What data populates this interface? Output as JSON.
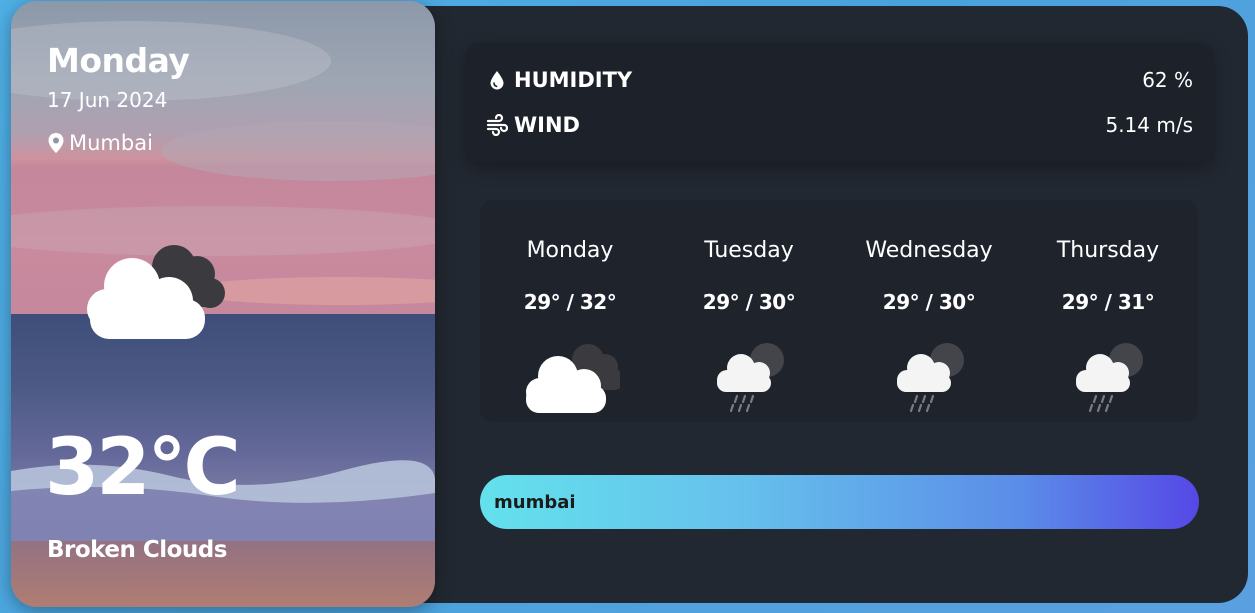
{
  "current": {
    "day": "Monday",
    "date": "17 Jun 2024",
    "location": "Mumbai",
    "location_icon": "map-pin-icon",
    "temperature": "32°C",
    "condition": "Broken Clouds",
    "condition_icon": "broken-clouds-icon"
  },
  "stats": {
    "humidity_label": "HUMIDITY",
    "humidity_value": "62 %",
    "humidity_icon": "water-drop-icon",
    "wind_label": "WIND",
    "wind_value": "5.14 m/s",
    "wind_icon": "wind-icon"
  },
  "forecast": [
    {
      "day": "Monday",
      "temp": "29° / 32°",
      "icon": "broken-clouds-icon"
    },
    {
      "day": "Tuesday",
      "temp": "29° / 30°",
      "icon": "rain-icon"
    },
    {
      "day": "Wednesday",
      "temp": "29° / 30°",
      "icon": "rain-icon"
    },
    {
      "day": "Thursday",
      "temp": "29° / 31°",
      "icon": "rain-icon"
    }
  ],
  "search": {
    "value": "mumbai"
  },
  "colors": {
    "panel": "#222831",
    "stats_box": "#1d2129",
    "search_gradient_start": "#63e1ec",
    "search_gradient_end": "#5548e6"
  }
}
